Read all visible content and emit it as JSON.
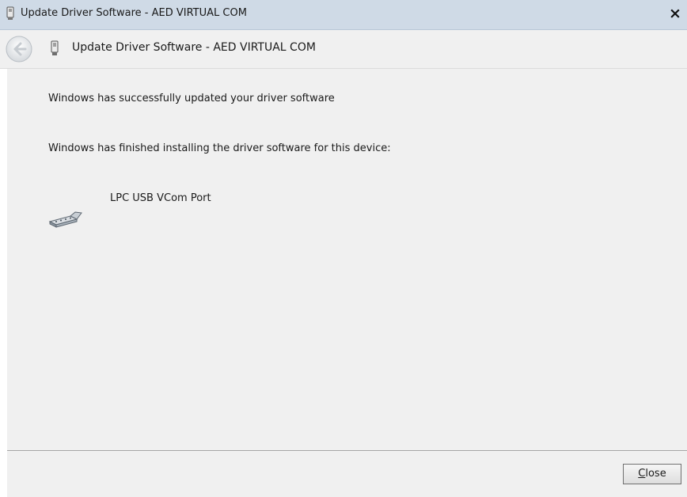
{
  "window": {
    "title": "Update Driver Software - AED VIRTUAL COM",
    "close_glyph": "×"
  },
  "header": {
    "title": "Update Driver Software - AED VIRTUAL COM",
    "back_icon": "back-arrow-icon",
    "device_icon": "usb-device-icon"
  },
  "content": {
    "success_message": "Windows has successfully updated your driver software",
    "finished_message": "Windows has finished installing the driver software for this device:",
    "device_name": "LPC USB VCom Port",
    "device_icon": "serial-port-icon"
  },
  "footer": {
    "close_mnemonic": "C",
    "close_rest": "lose"
  },
  "colors": {
    "titlebar": "#cfdae6",
    "background": "#f0f0f0"
  }
}
